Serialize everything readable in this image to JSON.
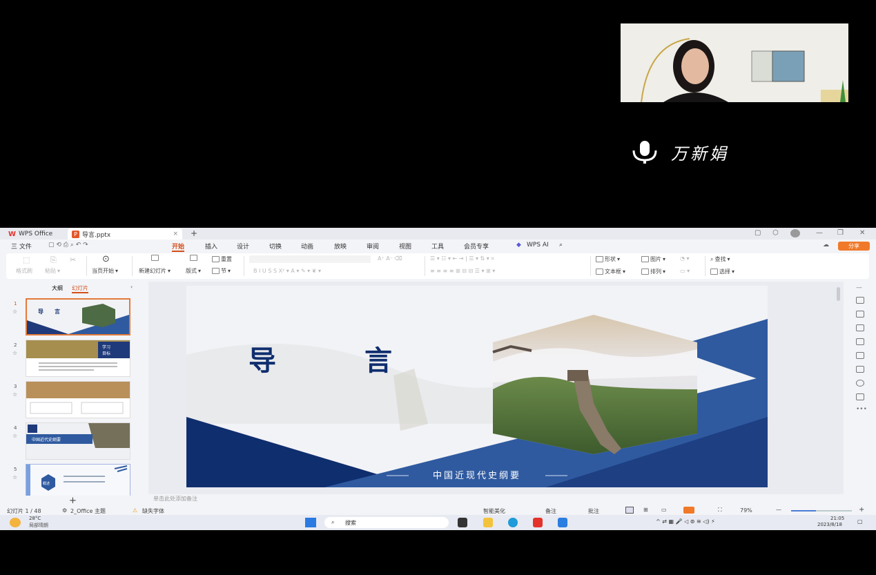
{
  "video_call": {
    "speaker_name": "万新娟",
    "mic_icon": "microphone-icon"
  },
  "app": {
    "titlebar": {
      "app_tab_label": "WPS Office",
      "doc_tab_label": "导言.pptx",
      "close_glyph": "×",
      "new_tab_glyph": "+"
    },
    "menubar": {
      "file": "三 文件",
      "items": [
        "开始",
        "插入",
        "设计",
        "切换",
        "动画",
        "放映",
        "审阅",
        "视图",
        "工具",
        "会员专享"
      ],
      "active": "开始",
      "ai_label": "WPS AI",
      "share_label": "分享"
    },
    "ribbon": {
      "format_painter": "格式刷",
      "paste": "粘贴",
      "play_from_current": "当页开始",
      "new_slide": "新建幻灯片",
      "layout": "版式",
      "reset": "重置",
      "section": "节",
      "shape": "形状",
      "picture": "图片",
      "textbox": "文本框",
      "arrange": "排列",
      "find": "查找",
      "select": "选择"
    },
    "left_panel": {
      "tab_outline": "大纲",
      "tab_slides": "幻灯片",
      "thumb2_heading": "学习目标",
      "thumb4_heading": "中国近代史纲要",
      "thumb5_label": "概述",
      "add_slide": "+"
    },
    "slide": {
      "title": "导　　　言",
      "subtitle": "中国近现代史纲要"
    },
    "notes_placeholder": "单击此处添加备注",
    "statusbar": {
      "slide_counter": "幻灯片 1 / 48",
      "theme": "2_Office 主题",
      "missing_font": "缺失字体",
      "smart_beautify": "智能美化",
      "notes": "备注",
      "comments": "批注",
      "zoom": "79%"
    },
    "taskbar": {
      "weather_temp": "28°C",
      "weather_desc": "局部晴朗",
      "search_label": "搜索",
      "time": "21:05",
      "date": "2023/8/18"
    }
  },
  "colors": {
    "accent": "#d44e1b",
    "slide_navy": "#1f3a7a",
    "slide_blue": "#2f5aa0"
  }
}
